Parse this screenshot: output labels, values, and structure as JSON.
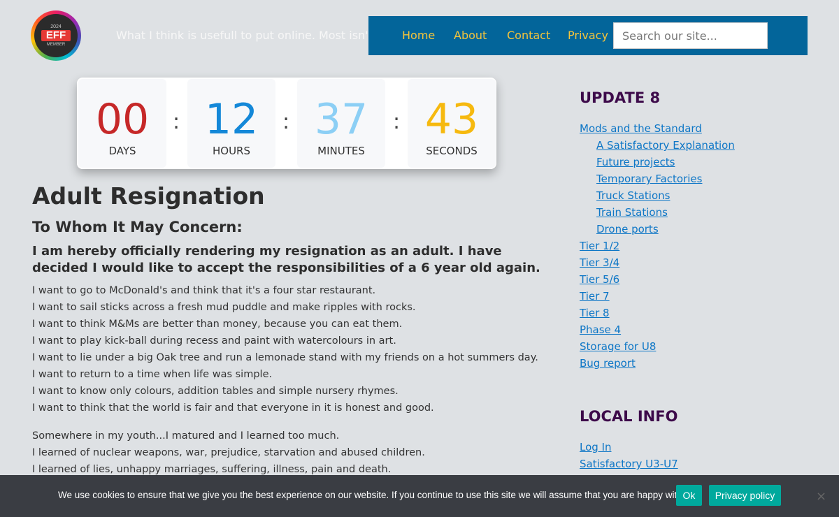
{
  "header": {
    "logo": {
      "year": "2024",
      "name": "EFF",
      "member": "MEMBER"
    },
    "tagline": "What I think is usefull to put online. Most isn't.",
    "nav": [
      "Home",
      "About",
      "Contact",
      "Privacy"
    ],
    "search_placeholder": "Search our site..."
  },
  "countdown": {
    "days": "00",
    "hours": "12",
    "minutes": "37",
    "seconds": "43",
    "labels": {
      "days": "DAYS",
      "hours": "HOURS",
      "minutes": "MINUTES",
      "seconds": "SECONDS"
    },
    "separator": ":",
    "colors": {
      "days": "#c62828",
      "hours": "#1488d8",
      "minutes": "#8ccff5",
      "seconds": "#f6b90f"
    }
  },
  "article": {
    "title": "Adult Resignation",
    "subtitle": "To Whom It May Concern:",
    "lead": "I am hereby officially rendering my resignation as an adult. I have decided I would like to accept the responsibilities of a 6 year old again.",
    "para1": [
      "I want to go to McDonald's and think that it's a four star restaurant.",
      "I want to sail sticks across a fresh mud puddle and make ripples with rocks.",
      "I want to think M&Ms are better than money, because you can eat them.",
      "I want to play kick-ball during recess and paint with watercolours in art.",
      "I want to lie under a big Oak tree and run a lemonade stand with my friends on a hot summers day.",
      "I want to return to a time when life was simple.",
      "I want to know only colours, addition tables and simple nursery rhymes.",
      "I want to think that the world is fair and that everyone in it is honest and good."
    ],
    "para2": [
      "Somewhere in my youth...I matured and I learned too much.",
      "I learned of nuclear weapons, war, prejudice, starvation and abused children.",
      "I learned of lies, unhappy marriages, suffering, illness, pain and death."
    ]
  },
  "sidebar": {
    "heading1": "UPDATE 8",
    "links1": [
      "Mods and the Standard",
      "A Satisfactory Explanation",
      "Future projects",
      "Temporary Factories",
      "Truck Stations",
      "Train Stations",
      "Drone ports",
      "Tier 1/2",
      "Tier 3/4",
      "Tier 5/6",
      "Tier 7",
      "Tier 8",
      "Phase 4",
      "Storage for U8",
      "Bug report"
    ],
    "heading2": "LOCAL INFO",
    "links2": [
      "Log In",
      "Satisfactory U3-U7"
    ]
  },
  "cookie": {
    "text": "We use cookies to ensure that we give you the best experience on our website. If you continue to use this site we will assume that you are happy with it.",
    "ok": "Ok",
    "policy": "Privacy policy",
    "close_icon": "close-icon",
    "close_glyph": "×"
  }
}
